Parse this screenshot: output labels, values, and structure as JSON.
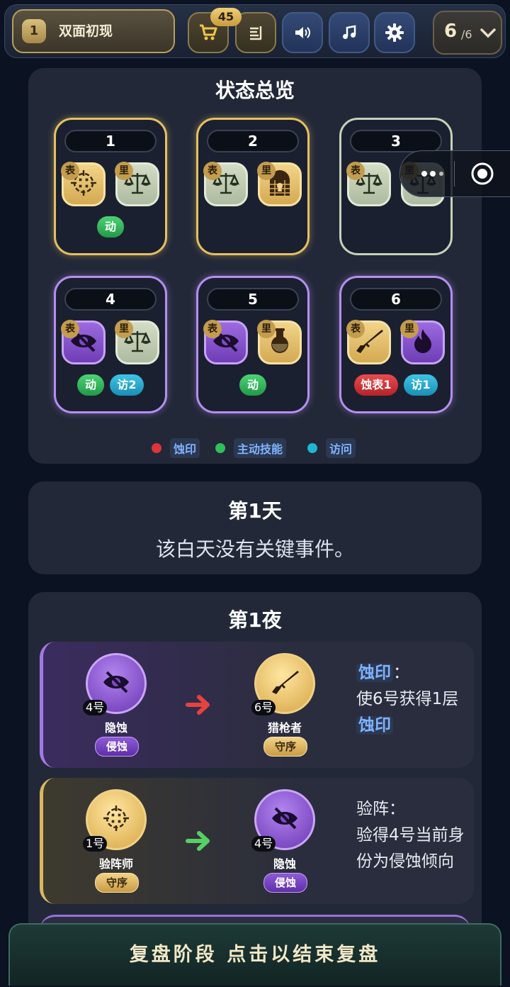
{
  "topbar": {
    "level_number": "1",
    "level_name": "双面初现",
    "cart_badge": "45",
    "buttons": [
      "shopping-cart-icon",
      "notes-icon",
      "sound-icon",
      "music-icon",
      "settings-icon"
    ],
    "page_current": "6",
    "page_total": "/6"
  },
  "overview": {
    "title": "状态总览",
    "face_label": "表",
    "back_label": "里",
    "seats": [
      {
        "num": "1",
        "border": "gold",
        "face_icon": "crosshair-icon",
        "face_style": "gold",
        "back_icon": "scales-icon",
        "back_style": "silver",
        "tags": [
          {
            "text": "动",
            "color": "green"
          }
        ]
      },
      {
        "num": "2",
        "border": "gold",
        "face_icon": "scales-icon",
        "face_style": "silver",
        "back_icon": "locked-door-icon",
        "back_style": "gold",
        "tags": []
      },
      {
        "num": "3",
        "border": "silver",
        "face_icon": "scales-icon",
        "face_style": "silver",
        "back_icon": "scales-icon",
        "back_style": "silver",
        "tags": []
      },
      {
        "num": "4",
        "border": "purple",
        "face_icon": "hidden-eye-icon",
        "face_style": "purple",
        "back_icon": "scales-icon",
        "back_style": "silver",
        "tags": [
          {
            "text": "动",
            "color": "green"
          },
          {
            "text": "访2",
            "color": "blue"
          }
        ]
      },
      {
        "num": "5",
        "border": "purple",
        "face_icon": "hidden-eye-icon",
        "face_style": "purple",
        "back_icon": "potion-icon",
        "back_style": "gold",
        "tags": [
          {
            "text": "动",
            "color": "green"
          }
        ]
      },
      {
        "num": "6",
        "border": "purple",
        "face_icon": "rifle-icon",
        "face_style": "gold",
        "back_icon": "flame-icon",
        "back_style": "purple",
        "tags": [
          {
            "text": "蚀表1",
            "color": "red"
          },
          {
            "text": "访1",
            "color": "blue"
          }
        ]
      }
    ],
    "legend": [
      {
        "label": "蚀印",
        "color": "#e0343c"
      },
      {
        "label": "主动技能",
        "color": "#2fbf5b"
      },
      {
        "label": "访问",
        "color": "#1fb6d6"
      }
    ]
  },
  "day": {
    "title": "第1天",
    "desc": "该白天没有关键事件。"
  },
  "night": {
    "title": "第1夜",
    "events": [
      {
        "actor": {
          "num": "4号",
          "name": "隐蚀",
          "camp": "侵蚀",
          "icon": "hidden-eye-icon"
        },
        "target": {
          "num": "6号",
          "name": "猎枪者",
          "camp": "守序",
          "icon": "rifle-icon"
        },
        "arrow_color": "#e5433f",
        "skill": "蚀印",
        "colon": "：",
        "text_a": "使6号获得1层",
        "keyword": "蚀印"
      },
      {
        "actor": {
          "num": "1号",
          "name": "验阵师",
          "camp": "守序",
          "icon": "crosshair-icon"
        },
        "target": {
          "num": "4号",
          "name": "隐蚀",
          "camp": "侵蚀",
          "icon": "hidden-eye-icon"
        },
        "arrow_color": "#56d066",
        "skill": "验阵：",
        "text": "验得4号当前身份为侵蚀倾向"
      }
    ]
  },
  "bottom_button": "复盘阶段 点击以结束复盘"
}
